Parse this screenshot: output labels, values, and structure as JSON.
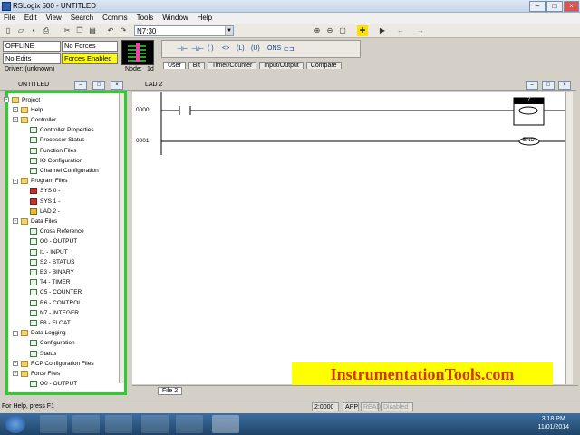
{
  "window": {
    "title": "RSLogix 500 - UNTITLED"
  },
  "menu": [
    "File",
    "Edit",
    "View",
    "Search",
    "Comms",
    "Tools",
    "Window",
    "Help"
  ],
  "toolbar": {
    "address_combo": "N7:30"
  },
  "status": {
    "mode": "OFFLINE",
    "forces": "No Forces",
    "edits": "No Edits",
    "forces_enabled": "Forces Enabled",
    "driver": "Driver: (unknown)",
    "node": "Node:",
    "node_value": "1d"
  },
  "instruction_tabs": [
    "User",
    "Bit",
    "Timer/Counter",
    "Input/Output",
    "Compare"
  ],
  "project_panel": {
    "title": "UNTITLED"
  },
  "tree": [
    {
      "label": "Project",
      "level": 0,
      "icon": "folder"
    },
    {
      "label": "Help",
      "level": 1,
      "icon": "folder"
    },
    {
      "label": "Controller",
      "level": 1,
      "icon": "folder"
    },
    {
      "label": "Controller Properties",
      "level": 2,
      "icon": "info"
    },
    {
      "label": "Processor Status",
      "level": 2,
      "icon": "doc"
    },
    {
      "label": "Function Files",
      "level": 2,
      "icon": "doc"
    },
    {
      "label": "IO Configuration",
      "level": 2,
      "icon": "io"
    },
    {
      "label": "Channel Configuration",
      "level": 2,
      "icon": "doc"
    },
    {
      "label": "Program Files",
      "level": 1,
      "icon": "folder"
    },
    {
      "label": "SYS 0 -",
      "level": 2,
      "icon": "red"
    },
    {
      "label": "SYS 1 -",
      "level": 2,
      "icon": "red"
    },
    {
      "label": "LAD 2 -",
      "level": 2,
      "icon": "yellow"
    },
    {
      "label": "Data Files",
      "level": 1,
      "icon": "folder"
    },
    {
      "label": "Cross Reference",
      "level": 2,
      "icon": "doc"
    },
    {
      "label": "O0 - OUTPUT",
      "level": 2,
      "icon": "doc"
    },
    {
      "label": "I1 - INPUT",
      "level": 2,
      "icon": "doc"
    },
    {
      "label": "S2 - STATUS",
      "level": 2,
      "icon": "doc"
    },
    {
      "label": "B3 - BINARY",
      "level": 2,
      "icon": "doc"
    },
    {
      "label": "T4 - TIMER",
      "level": 2,
      "icon": "doc"
    },
    {
      "label": "C5 - COUNTER",
      "level": 2,
      "icon": "doc"
    },
    {
      "label": "R6 - CONTROL",
      "level": 2,
      "icon": "doc"
    },
    {
      "label": "N7 - INTEGER",
      "level": 2,
      "icon": "doc"
    },
    {
      "label": "F8 - FLOAT",
      "level": 2,
      "icon": "doc"
    },
    {
      "label": "Data Logging",
      "level": 1,
      "icon": "folder"
    },
    {
      "label": "Configuration",
      "level": 2,
      "icon": "doc"
    },
    {
      "label": "Status",
      "level": 2,
      "icon": "doc"
    },
    {
      "label": "RCP Configuration Files",
      "level": 1,
      "icon": "folder"
    },
    {
      "label": "Force Files",
      "level": 1,
      "icon": "folder"
    },
    {
      "label": "O0 - OUTPUT",
      "level": 2,
      "icon": "doc"
    }
  ],
  "ladder": {
    "title": "LAD 2",
    "rungs": [
      "0000",
      "0001"
    ],
    "coil_question": "?",
    "end_label": "END",
    "file_tab": "File 2"
  },
  "banner": "InstrumentationTools.com",
  "help_bar": {
    "help_text": "For Help, press F1",
    "address": "2:0000",
    "app": "APP",
    "read": "READ",
    "disabled": "Disabled"
  },
  "clock": {
    "time": "3:18 PM",
    "date": "11/01/2014"
  }
}
